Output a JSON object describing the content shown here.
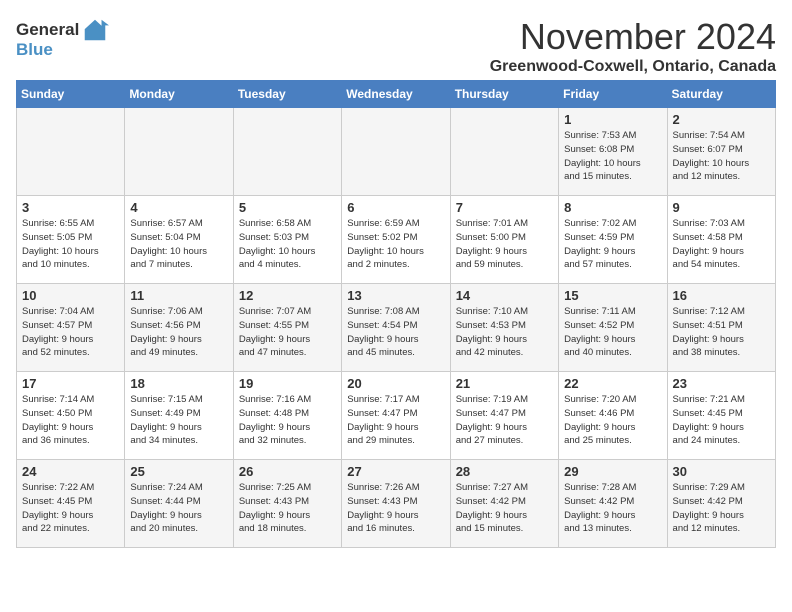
{
  "header": {
    "logo_general": "General",
    "logo_blue": "Blue",
    "month_title": "November 2024",
    "location": "Greenwood-Coxwell, Ontario, Canada"
  },
  "weekdays": [
    "Sunday",
    "Monday",
    "Tuesday",
    "Wednesday",
    "Thursday",
    "Friday",
    "Saturday"
  ],
  "weeks": [
    [
      {
        "day": "",
        "info": ""
      },
      {
        "day": "",
        "info": ""
      },
      {
        "day": "",
        "info": ""
      },
      {
        "day": "",
        "info": ""
      },
      {
        "day": "",
        "info": ""
      },
      {
        "day": "1",
        "info": "Sunrise: 7:53 AM\nSunset: 6:08 PM\nDaylight: 10 hours\nand 15 minutes."
      },
      {
        "day": "2",
        "info": "Sunrise: 7:54 AM\nSunset: 6:07 PM\nDaylight: 10 hours\nand 12 minutes."
      }
    ],
    [
      {
        "day": "3",
        "info": "Sunrise: 6:55 AM\nSunset: 5:05 PM\nDaylight: 10 hours\nand 10 minutes."
      },
      {
        "day": "4",
        "info": "Sunrise: 6:57 AM\nSunset: 5:04 PM\nDaylight: 10 hours\nand 7 minutes."
      },
      {
        "day": "5",
        "info": "Sunrise: 6:58 AM\nSunset: 5:03 PM\nDaylight: 10 hours\nand 4 minutes."
      },
      {
        "day": "6",
        "info": "Sunrise: 6:59 AM\nSunset: 5:02 PM\nDaylight: 10 hours\nand 2 minutes."
      },
      {
        "day": "7",
        "info": "Sunrise: 7:01 AM\nSunset: 5:00 PM\nDaylight: 9 hours\nand 59 minutes."
      },
      {
        "day": "8",
        "info": "Sunrise: 7:02 AM\nSunset: 4:59 PM\nDaylight: 9 hours\nand 57 minutes."
      },
      {
        "day": "9",
        "info": "Sunrise: 7:03 AM\nSunset: 4:58 PM\nDaylight: 9 hours\nand 54 minutes."
      }
    ],
    [
      {
        "day": "10",
        "info": "Sunrise: 7:04 AM\nSunset: 4:57 PM\nDaylight: 9 hours\nand 52 minutes."
      },
      {
        "day": "11",
        "info": "Sunrise: 7:06 AM\nSunset: 4:56 PM\nDaylight: 9 hours\nand 49 minutes."
      },
      {
        "day": "12",
        "info": "Sunrise: 7:07 AM\nSunset: 4:55 PM\nDaylight: 9 hours\nand 47 minutes."
      },
      {
        "day": "13",
        "info": "Sunrise: 7:08 AM\nSunset: 4:54 PM\nDaylight: 9 hours\nand 45 minutes."
      },
      {
        "day": "14",
        "info": "Sunrise: 7:10 AM\nSunset: 4:53 PM\nDaylight: 9 hours\nand 42 minutes."
      },
      {
        "day": "15",
        "info": "Sunrise: 7:11 AM\nSunset: 4:52 PM\nDaylight: 9 hours\nand 40 minutes."
      },
      {
        "day": "16",
        "info": "Sunrise: 7:12 AM\nSunset: 4:51 PM\nDaylight: 9 hours\nand 38 minutes."
      }
    ],
    [
      {
        "day": "17",
        "info": "Sunrise: 7:14 AM\nSunset: 4:50 PM\nDaylight: 9 hours\nand 36 minutes."
      },
      {
        "day": "18",
        "info": "Sunrise: 7:15 AM\nSunset: 4:49 PM\nDaylight: 9 hours\nand 34 minutes."
      },
      {
        "day": "19",
        "info": "Sunrise: 7:16 AM\nSunset: 4:48 PM\nDaylight: 9 hours\nand 32 minutes."
      },
      {
        "day": "20",
        "info": "Sunrise: 7:17 AM\nSunset: 4:47 PM\nDaylight: 9 hours\nand 29 minutes."
      },
      {
        "day": "21",
        "info": "Sunrise: 7:19 AM\nSunset: 4:47 PM\nDaylight: 9 hours\nand 27 minutes."
      },
      {
        "day": "22",
        "info": "Sunrise: 7:20 AM\nSunset: 4:46 PM\nDaylight: 9 hours\nand 25 minutes."
      },
      {
        "day": "23",
        "info": "Sunrise: 7:21 AM\nSunset: 4:45 PM\nDaylight: 9 hours\nand 24 minutes."
      }
    ],
    [
      {
        "day": "24",
        "info": "Sunrise: 7:22 AM\nSunset: 4:45 PM\nDaylight: 9 hours\nand 22 minutes."
      },
      {
        "day": "25",
        "info": "Sunrise: 7:24 AM\nSunset: 4:44 PM\nDaylight: 9 hours\nand 20 minutes."
      },
      {
        "day": "26",
        "info": "Sunrise: 7:25 AM\nSunset: 4:43 PM\nDaylight: 9 hours\nand 18 minutes."
      },
      {
        "day": "27",
        "info": "Sunrise: 7:26 AM\nSunset: 4:43 PM\nDaylight: 9 hours\nand 16 minutes."
      },
      {
        "day": "28",
        "info": "Sunrise: 7:27 AM\nSunset: 4:42 PM\nDaylight: 9 hours\nand 15 minutes."
      },
      {
        "day": "29",
        "info": "Sunrise: 7:28 AM\nSunset: 4:42 PM\nDaylight: 9 hours\nand 13 minutes."
      },
      {
        "day": "30",
        "info": "Sunrise: 7:29 AM\nSunset: 4:42 PM\nDaylight: 9 hours\nand 12 minutes."
      }
    ]
  ]
}
